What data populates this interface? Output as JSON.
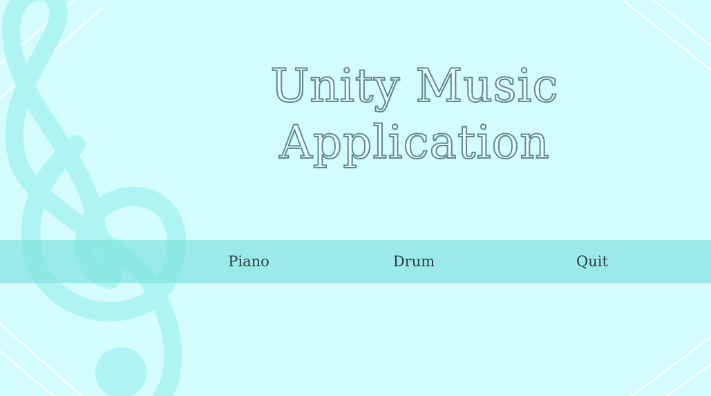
{
  "window": {
    "title_line1": "Unity Music",
    "title_line2": "Application"
  },
  "menu": {
    "items": [
      {
        "label": "Piano"
      },
      {
        "label": "Drum"
      },
      {
        "label": "Quit"
      }
    ]
  },
  "colors": {
    "background": "#d4fcfc",
    "clef": "#aef4f2",
    "menu_bar": "#9aeae6",
    "title_outline": "#5c8a90",
    "menu_text": "#2b3c3f"
  },
  "icons": {
    "background_decoration": "treble-clef-icon"
  }
}
